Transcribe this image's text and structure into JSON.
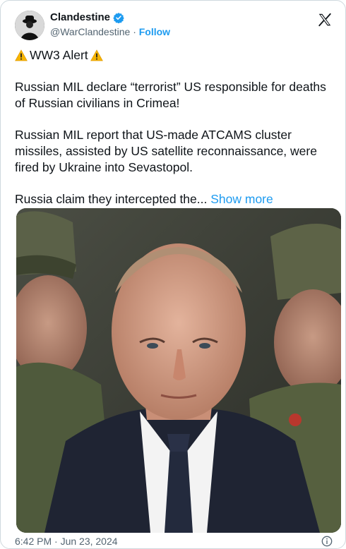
{
  "tweet": {
    "display_name": "Clandestine",
    "handle": "@WarClandestine",
    "separator": "·",
    "follow_label": "Follow",
    "alert_text": "WW3 Alert",
    "paragraph_1": "Russian MIL declare “terrorist” US responsible for deaths of Russian civilians in Crimea!",
    "paragraph_2": "Russian MIL report that US-made ATCAMS cluster missiles, assisted by US satellite reconnaissance, were fired by Ukraine into Sevastopol.",
    "paragraph_3": "Russia claim they intercepted the...",
    "show_more_label": "Show more",
    "timestamp": "6:42 PM · Jun 23, 2024"
  },
  "icons": {
    "verified": "verified-badge-icon",
    "platform": "x-logo-icon",
    "warning": "warning-icon",
    "info": "info-icon"
  },
  "colors": {
    "link": "#1d9bf0",
    "secondary_text": "#536471",
    "warning_fill": "#f5b400"
  }
}
